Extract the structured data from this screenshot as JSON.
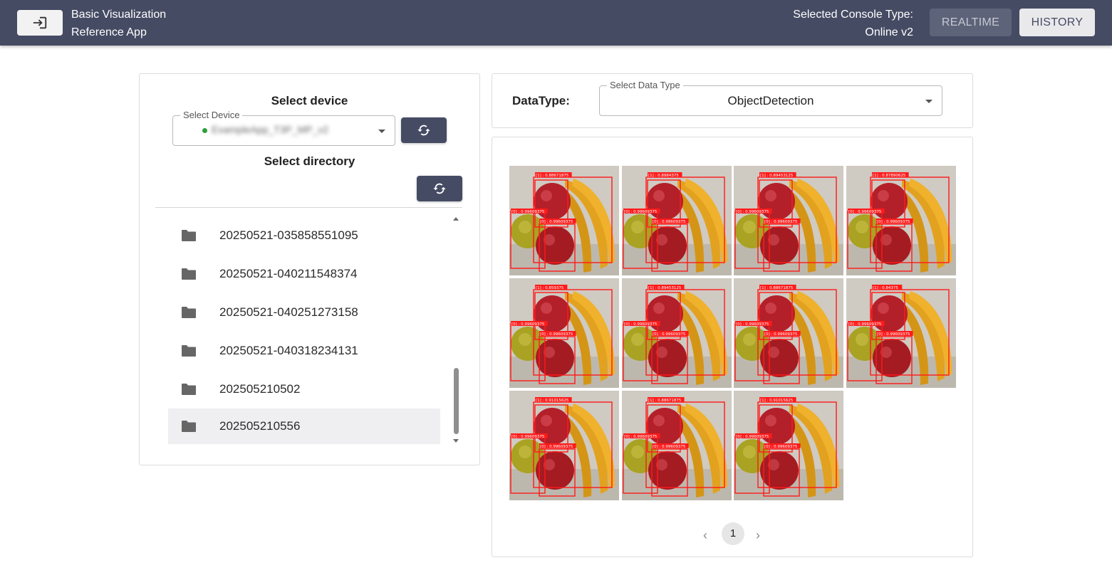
{
  "header": {
    "app_title_line1": "Basic Visualization",
    "app_title_line2": "Reference App",
    "console_type_line1": "Selected Console Type:",
    "console_type_line2": "Online v2",
    "realtime_label": "REALTIME",
    "history_label": "HISTORY",
    "exit_icon": "login-icon"
  },
  "device_panel": {
    "title": "Select device",
    "select_label": "Select Device",
    "selected_device": "ExampleApp_T3P_MP_v2",
    "status_color": "#2e9e3e",
    "refresh_icon": "refresh-icon"
  },
  "directory_panel": {
    "title": "Select directory",
    "refresh_icon": "refresh-icon",
    "items": [
      {
        "label": "20250521-035858551095",
        "selected": false
      },
      {
        "label": "20250521-040211548374",
        "selected": false
      },
      {
        "label": "20250521-040251273158",
        "selected": false
      },
      {
        "label": "20250521-040318234131",
        "selected": false
      },
      {
        "label": "202505210502",
        "selected": false
      },
      {
        "label": "202505210556",
        "selected": true
      }
    ]
  },
  "data_type": {
    "label": "DataType:",
    "select_label": "Select Data Type",
    "selected_value": "ObjectDetection"
  },
  "images": {
    "count": 11,
    "thumbnails": [
      {
        "labels": [
          "[1] : 0.88671875",
          "[0] : 0.99609375",
          "[0] : 0.99609375"
        ]
      },
      {
        "labels": [
          "[1] : 0.8984375",
          "[0] : 0.99609375",
          "[0] : 0.99609375"
        ]
      },
      {
        "labels": [
          "[1] : 0.89453125",
          "[0] : 0.99609375",
          "[0] : 0.99609375"
        ]
      },
      {
        "labels": [
          "[1] : 0.87890625",
          "[0] : 0.99609375",
          "[0] : 0.99609375"
        ]
      },
      {
        "labels": [
          "[1] : 0.859375",
          "[0] : 0.99609375",
          "[0] : 0.99609375"
        ]
      },
      {
        "labels": [
          "[1] : 0.89453125",
          "[0] : 0.99609375",
          "[0] : 0.99609375"
        ]
      },
      {
        "labels": [
          "[1] : 0.88671875",
          "[0] : 0.99609375",
          "[0] : 0.99609375"
        ]
      },
      {
        "labels": [
          "[1] : 0.84375",
          "[0] : 0.99609375",
          "[0] : 0.99609375"
        ]
      },
      {
        "labels": [
          "[1] : 0.91015625",
          "[0] : 0.99609375",
          "[0] : 0.99609375"
        ]
      },
      {
        "labels": [
          "[1] : 0.88671875",
          "[0] : 0.99609375",
          "[0] : 0.99609375"
        ]
      },
      {
        "labels": [
          "[1] : 0.91015625",
          "[0] : 0.99609375",
          "[0] : 0.99609375"
        ]
      }
    ]
  },
  "pagination": {
    "current_page": "1",
    "prev_icon": "chevron-left-icon",
    "next_icon": "chevron-right-icon"
  },
  "colors": {
    "appbar": "#454b63",
    "detection_box": "#ff1a1a"
  }
}
